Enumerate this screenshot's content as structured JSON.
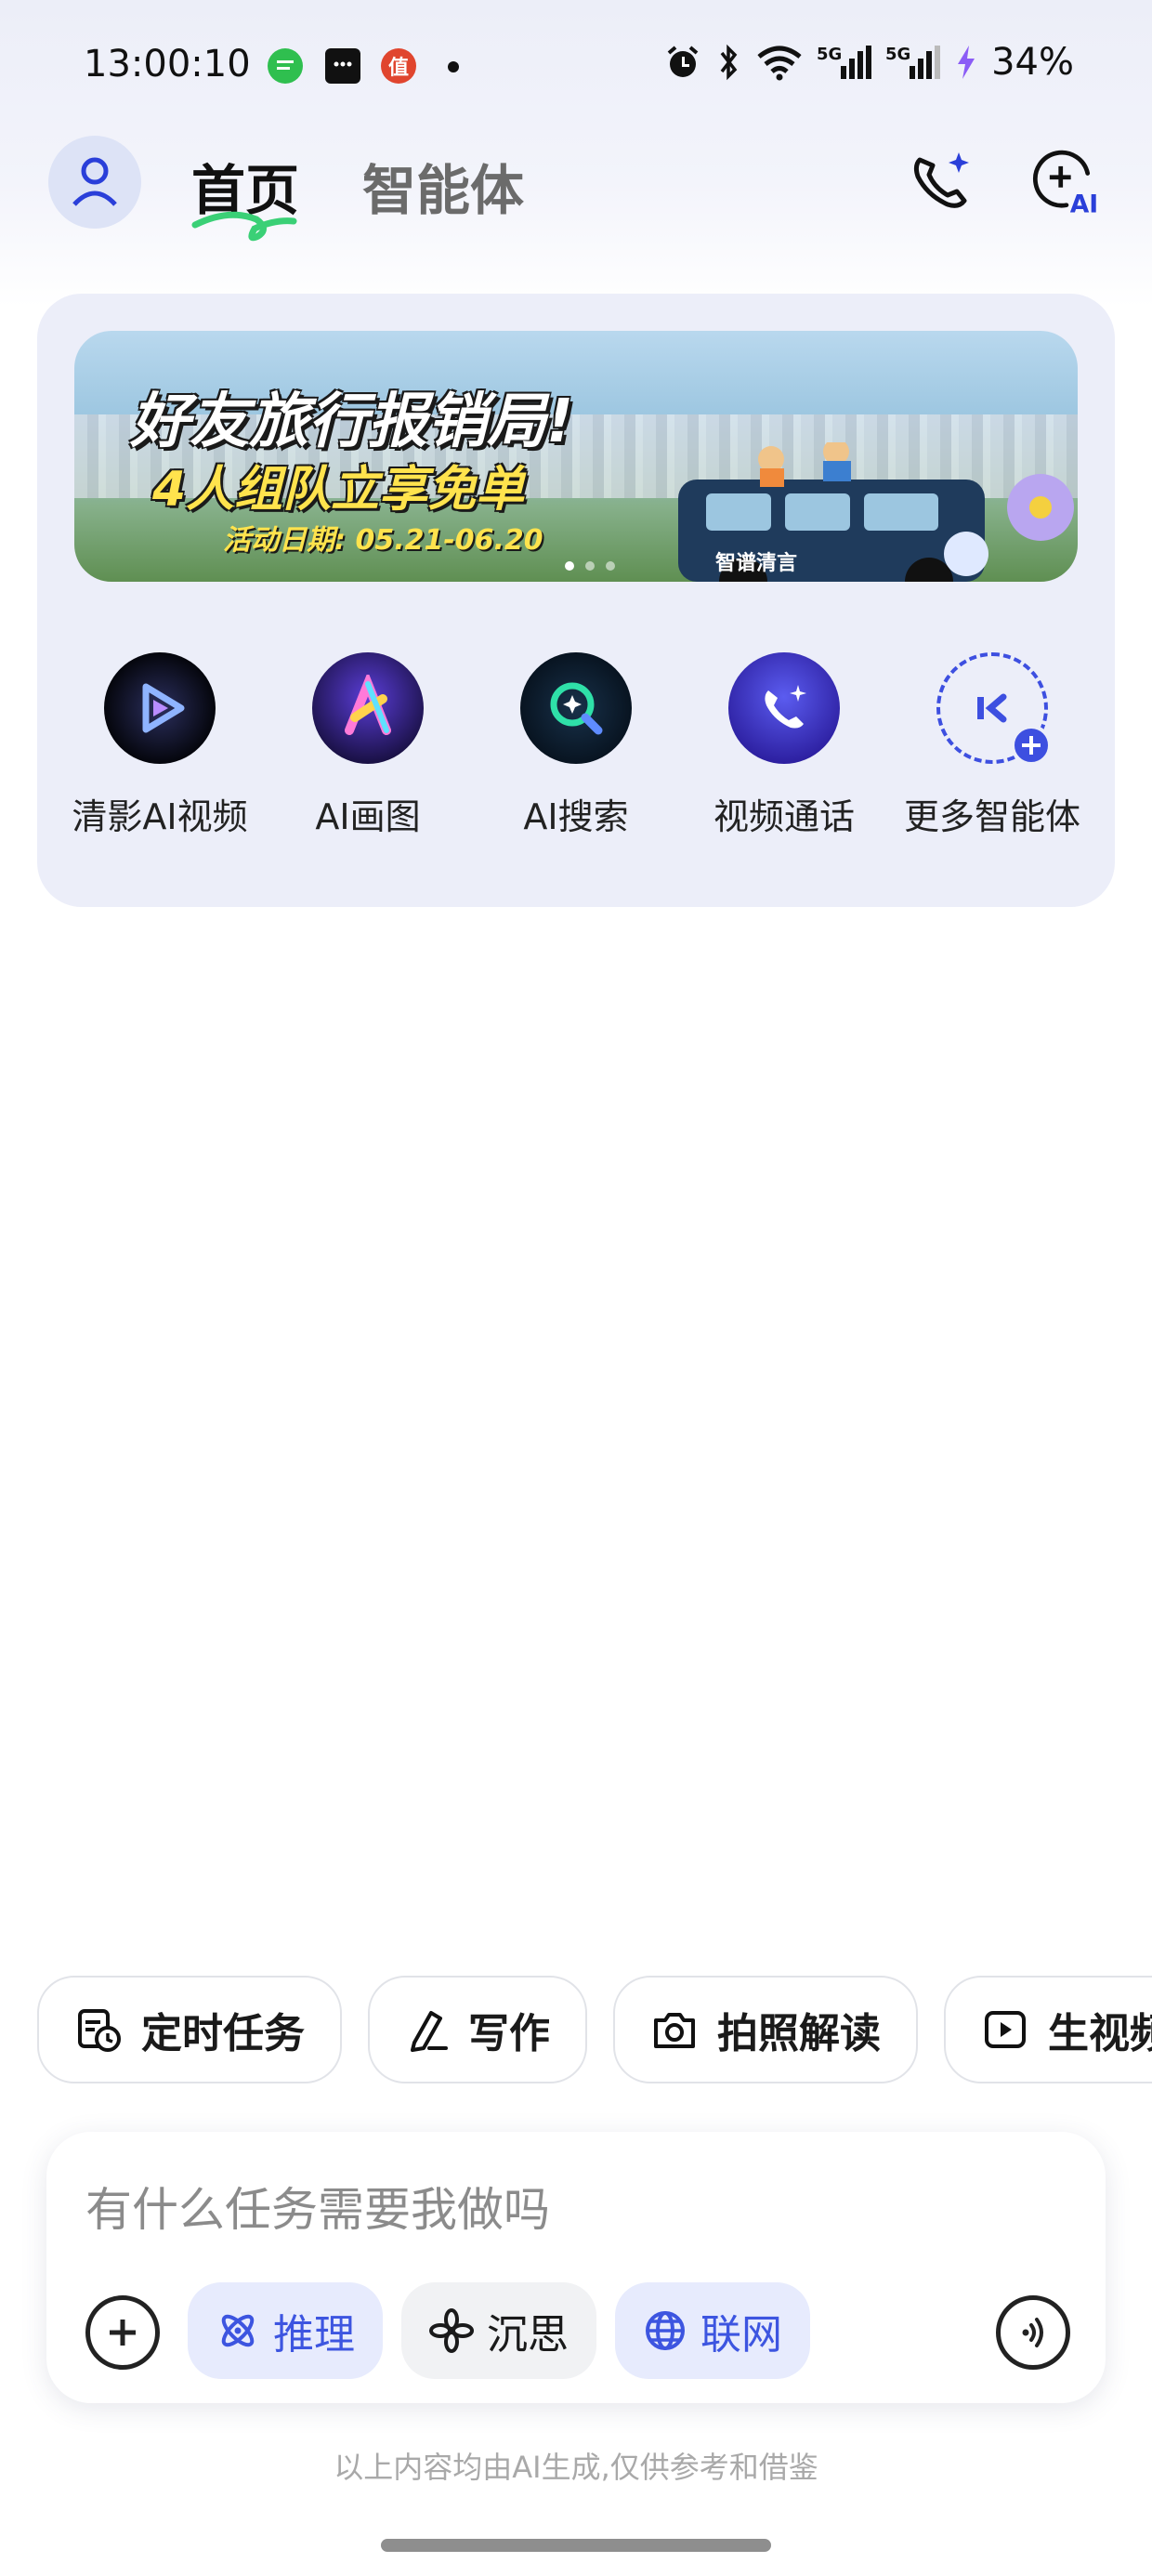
{
  "status_bar": {
    "time": "13:00:10",
    "battery": "34%",
    "network": "5G",
    "icons": [
      "chat-bubble-icon",
      "message-icon",
      "app-badge-icon",
      "dot-icon",
      "alarm-icon",
      "bluetooth-icon",
      "wifi-icon",
      "signal-icon",
      "signal-icon",
      "charging-icon"
    ],
    "notification_badge": "值"
  },
  "header": {
    "tabs": [
      {
        "label": "首页",
        "active": true
      },
      {
        "label": "智能体",
        "active": false
      }
    ],
    "icons": [
      "profile-icon",
      "phone-ai-icon",
      "add-ai-icon"
    ],
    "accent_color": "#1e2fd6",
    "underline_color": "#33cc66"
  },
  "banner": {
    "title": "好友旅行报销局!",
    "subtitle": "4人组队立享免单",
    "date": "活动日期: 05.21-06.20",
    "brand": "智谱清言",
    "page_count": 3,
    "active_page": 1
  },
  "shortcuts": [
    {
      "label": "清影AI视频",
      "icon": "video-play-icon"
    },
    {
      "label": "AI画图",
      "icon": "ai-draw-icon"
    },
    {
      "label": "AI搜索",
      "icon": "ai-search-icon"
    },
    {
      "label": "视频通话",
      "icon": "video-call-icon"
    },
    {
      "label": "更多智能体",
      "icon": "more-agents-icon"
    }
  ],
  "chips": [
    {
      "label": "定时任务",
      "icon": "scheduled-task-icon"
    },
    {
      "label": "写作",
      "icon": "pen-icon"
    },
    {
      "label": "拍照解读",
      "icon": "camera-icon"
    },
    {
      "label": "生视频",
      "icon": "play-icon"
    }
  ],
  "composer": {
    "placeholder": "有什么任务需要我做吗",
    "modes": [
      {
        "label": "推理",
        "icon": "atom-icon",
        "active": true
      },
      {
        "label": "沉思",
        "icon": "flower-icon",
        "active": false
      },
      {
        "label": "联网",
        "icon": "globe-icon",
        "active": true
      }
    ],
    "icons": [
      "plus-icon",
      "voice-icon"
    ]
  },
  "footer": {
    "disclaimer": "以上内容均由AI生成,仅供参考和借鉴"
  }
}
